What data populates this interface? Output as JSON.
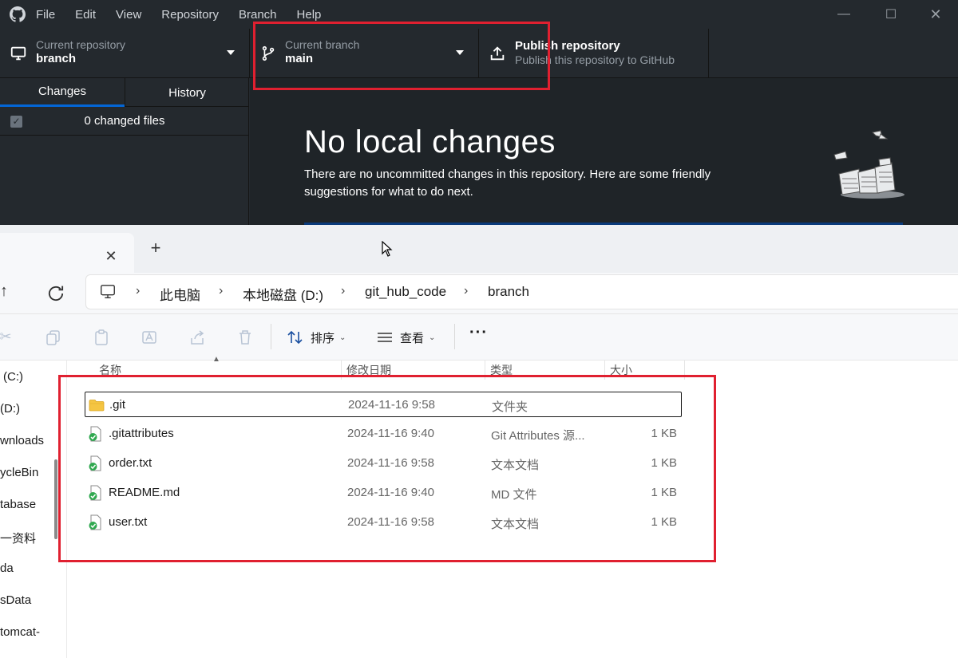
{
  "github_desktop": {
    "menu": [
      "File",
      "Edit",
      "View",
      "Repository",
      "Branch",
      "Help"
    ],
    "repository": {
      "label": "Current repository",
      "value": "branch"
    },
    "branch": {
      "label": "Current branch",
      "value": "main"
    },
    "publish": {
      "title": "Publish repository",
      "subtitle": "Publish this repository to GitHub"
    },
    "tabs": [
      "Changes",
      "History"
    ],
    "changed_files": "0 changed files",
    "main": {
      "heading": "No local changes",
      "description": "There are no uncommitted changes in this repository. Here are some friendly suggestions for what to do next."
    }
  },
  "explorer": {
    "breadcrumb": [
      "此电脑",
      "本地磁盘 (D:)",
      "git_hub_code",
      "branch"
    ],
    "commands": {
      "sort": "排序",
      "view": "查看",
      "more": "···"
    },
    "nav": [
      "(C:)",
      "(D:)",
      "wnloads",
      "ycleBin",
      "tabase",
      "一资料",
      "da",
      "sData",
      "tomcat-"
    ],
    "columns": {
      "name": "名称",
      "date": "修改日期",
      "type": "类型",
      "size": "大小"
    },
    "files": [
      {
        "name": ".git",
        "date": "2024-11-16 9:58",
        "type": "文件夹",
        "size": "",
        "icon": "folder-icon"
      },
      {
        "name": ".gitattributes",
        "date": "2024-11-16 9:40",
        "type": "Git Attributes 源...",
        "size": "1 KB",
        "icon": "file-synced-icon"
      },
      {
        "name": "order.txt",
        "date": "2024-11-16 9:58",
        "type": "文本文档",
        "size": "1 KB",
        "icon": "file-synced-icon"
      },
      {
        "name": "README.md",
        "date": "2024-11-16 9:40",
        "type": "MD 文件",
        "size": "1 KB",
        "icon": "file-synced-icon"
      },
      {
        "name": "user.txt",
        "date": "2024-11-16 9:58",
        "type": "文本文档",
        "size": "1 KB",
        "icon": "file-synced-icon"
      }
    ]
  },
  "colors": {
    "annotation_red": "#e02030",
    "github_bg": "#24292e",
    "accent_blue": "#0366d6"
  }
}
